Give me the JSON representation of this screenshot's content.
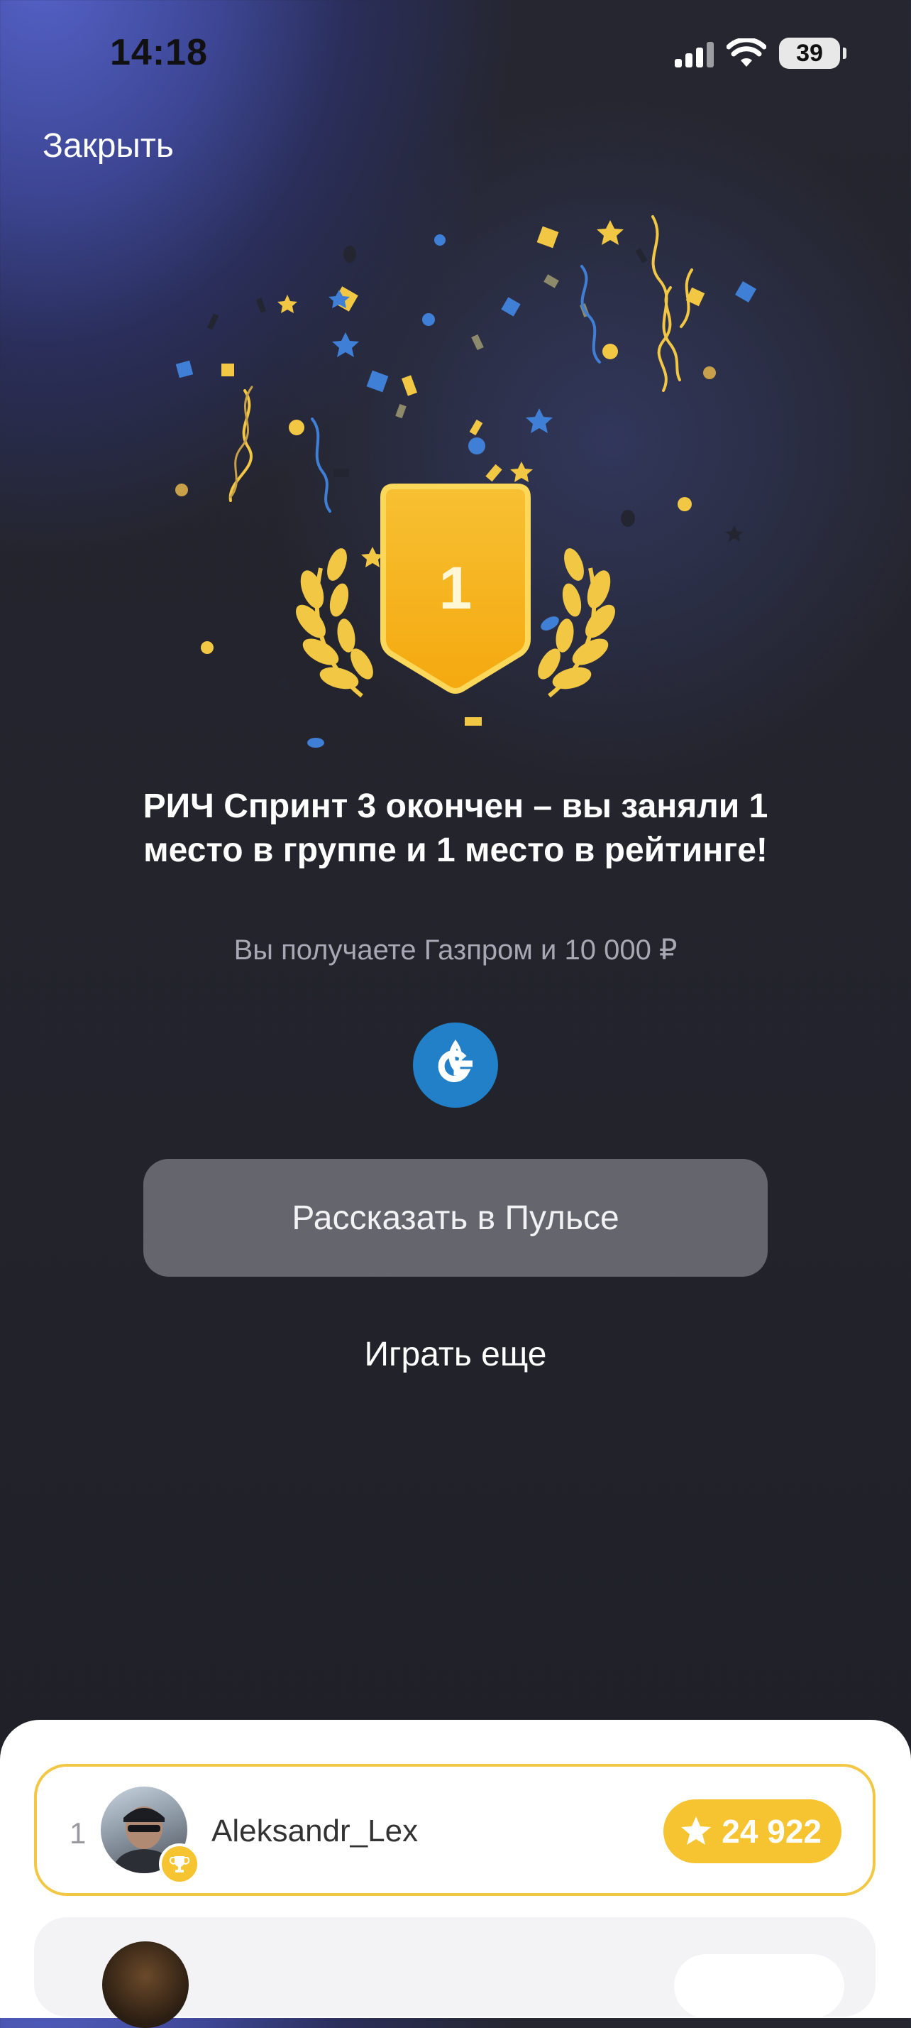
{
  "status_bar": {
    "time": "14:18",
    "battery": "39"
  },
  "header": {
    "close_label": "Закрыть"
  },
  "result": {
    "headline": "РИЧ Спринт 3 окончен – вы заняли 1 место в группе и 1 место в рейтинге!",
    "place": "1",
    "reward_text": "Вы получаете Газпром и 10 000 ₽"
  },
  "actions": {
    "share_label": "Рассказать в Пульсе",
    "play_again_label": "Играть еще"
  },
  "leaderboard": {
    "rows": [
      {
        "rank": "1",
        "username": "Aleksandr_Lex",
        "score": "24 922"
      }
    ]
  },
  "colors": {
    "accent_gold": "#f5c430",
    "button_gray": "#65656d",
    "gazprom_blue": "#2180c8"
  }
}
